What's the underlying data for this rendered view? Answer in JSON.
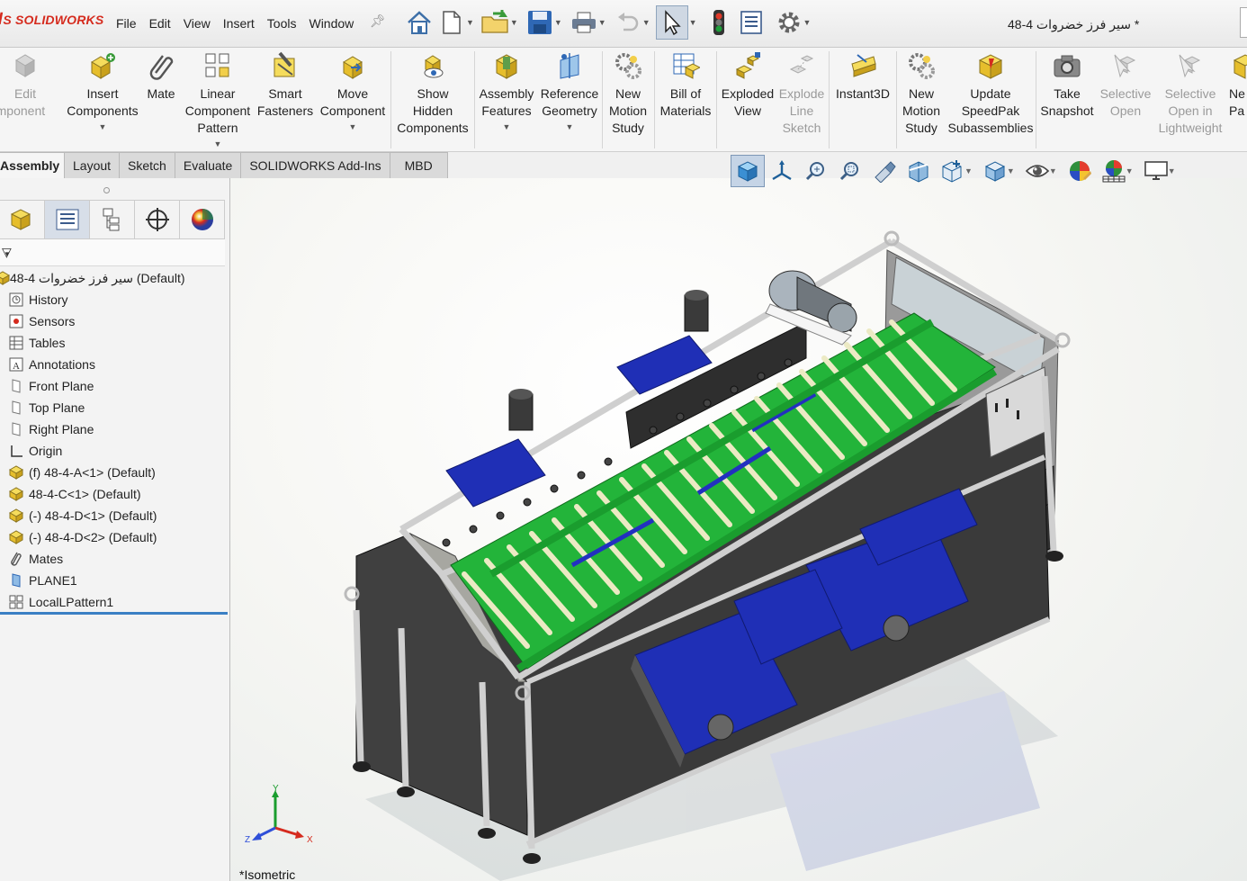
{
  "app": {
    "brand": "SOLIDWORKS"
  },
  "menu": [
    "File",
    "Edit",
    "View",
    "Insert",
    "Tools",
    "Window"
  ],
  "document_title": "سیر فرز خضروات 4-48 *",
  "ribbon": {
    "edit_component": {
      "line1": "Edit",
      "line2": "omponent"
    },
    "insert_components": {
      "line1": "Insert",
      "line2": "Components"
    },
    "mate": {
      "line1": "Mate"
    },
    "linear_pattern": {
      "line1": "Linear",
      "line2": "Component",
      "line3": "Pattern"
    },
    "smart_fasteners": {
      "line1": "Smart",
      "line2": "Fasteners"
    },
    "move_component": {
      "line1": "Move",
      "line2": "Component"
    },
    "show_hidden": {
      "line1": "Show",
      "line2": "Hidden",
      "line3": "Components"
    },
    "assembly_features": {
      "line1": "Assembly",
      "line2": "Features"
    },
    "reference_geometry": {
      "line1": "Reference",
      "line2": "Geometry"
    },
    "new_motion_study_1": {
      "line1": "New",
      "line2": "Motion",
      "line3": "Study"
    },
    "bill_of_materials": {
      "line1": "Bill of",
      "line2": "Materials"
    },
    "exploded_view": {
      "line1": "Exploded",
      "line2": "View"
    },
    "explode_line_sketch": {
      "line1": "Explode",
      "line2": "Line",
      "line3": "Sketch"
    },
    "instant3d": {
      "line1": "Instant3D"
    },
    "new_motion_study_2": {
      "line1": "New",
      "line2": "Motion",
      "line3": "Study"
    },
    "speedpak": {
      "line1": "Update",
      "line2": "SpeedPak",
      "line3": "Subassemblies"
    },
    "take_snapshot": {
      "line1": "Take",
      "line2": "Snapshot"
    },
    "selective_open": {
      "line1": "Selective",
      "line2": "Open"
    },
    "selective_open_lw": {
      "line1": "Selective",
      "line2": "Open in",
      "line3": "Lightweight"
    },
    "new_part": {
      "line1": "Ne",
      "line2": "Pa"
    }
  },
  "tabs": [
    "Assembly",
    "Layout",
    "Sketch",
    "Evaluate",
    "SOLIDWORKS Add-Ins",
    "MBD"
  ],
  "tree": {
    "root": "سیر فرز خضروات 4-48 (Default)",
    "items": [
      {
        "label": "History",
        "icon": "history-icon"
      },
      {
        "label": "Sensors",
        "icon": "sensors-icon"
      },
      {
        "label": "Tables",
        "icon": "tables-icon"
      },
      {
        "label": "Annotations",
        "icon": "annotations-icon"
      },
      {
        "label": "Front Plane",
        "icon": "plane-icon"
      },
      {
        "label": "Top Plane",
        "icon": "plane-icon"
      },
      {
        "label": "Right Plane",
        "icon": "plane-icon"
      },
      {
        "label": "Origin",
        "icon": "origin-icon"
      },
      {
        "label": "(f) 48-4-A<1> (Default)",
        "icon": "assembly-icon"
      },
      {
        "label": "48-4-C<1> (Default)",
        "icon": "assembly-icon"
      },
      {
        "label": "(-) 48-4-D<1> (Default)",
        "icon": "assembly-icon"
      },
      {
        "label": "(-) 48-4-D<2> (Default)",
        "icon": "assembly-icon"
      },
      {
        "label": "Mates",
        "icon": "mates-icon"
      },
      {
        "label": "PLANE1",
        "icon": "plane-icon"
      },
      {
        "label": "LocalLPattern1",
        "icon": "pattern-icon"
      }
    ]
  },
  "viewport": {
    "view_name": "*Isometric",
    "axes": {
      "x": "X",
      "y": "Y",
      "z": "Z"
    }
  },
  "colors": {
    "accent_blue": "#2f4fd8",
    "accent_green": "#2ecc40",
    "frame_grey": "#c9c9c9",
    "panel_dark": "#3b3b3b",
    "brand_red": "#d52b1e"
  }
}
